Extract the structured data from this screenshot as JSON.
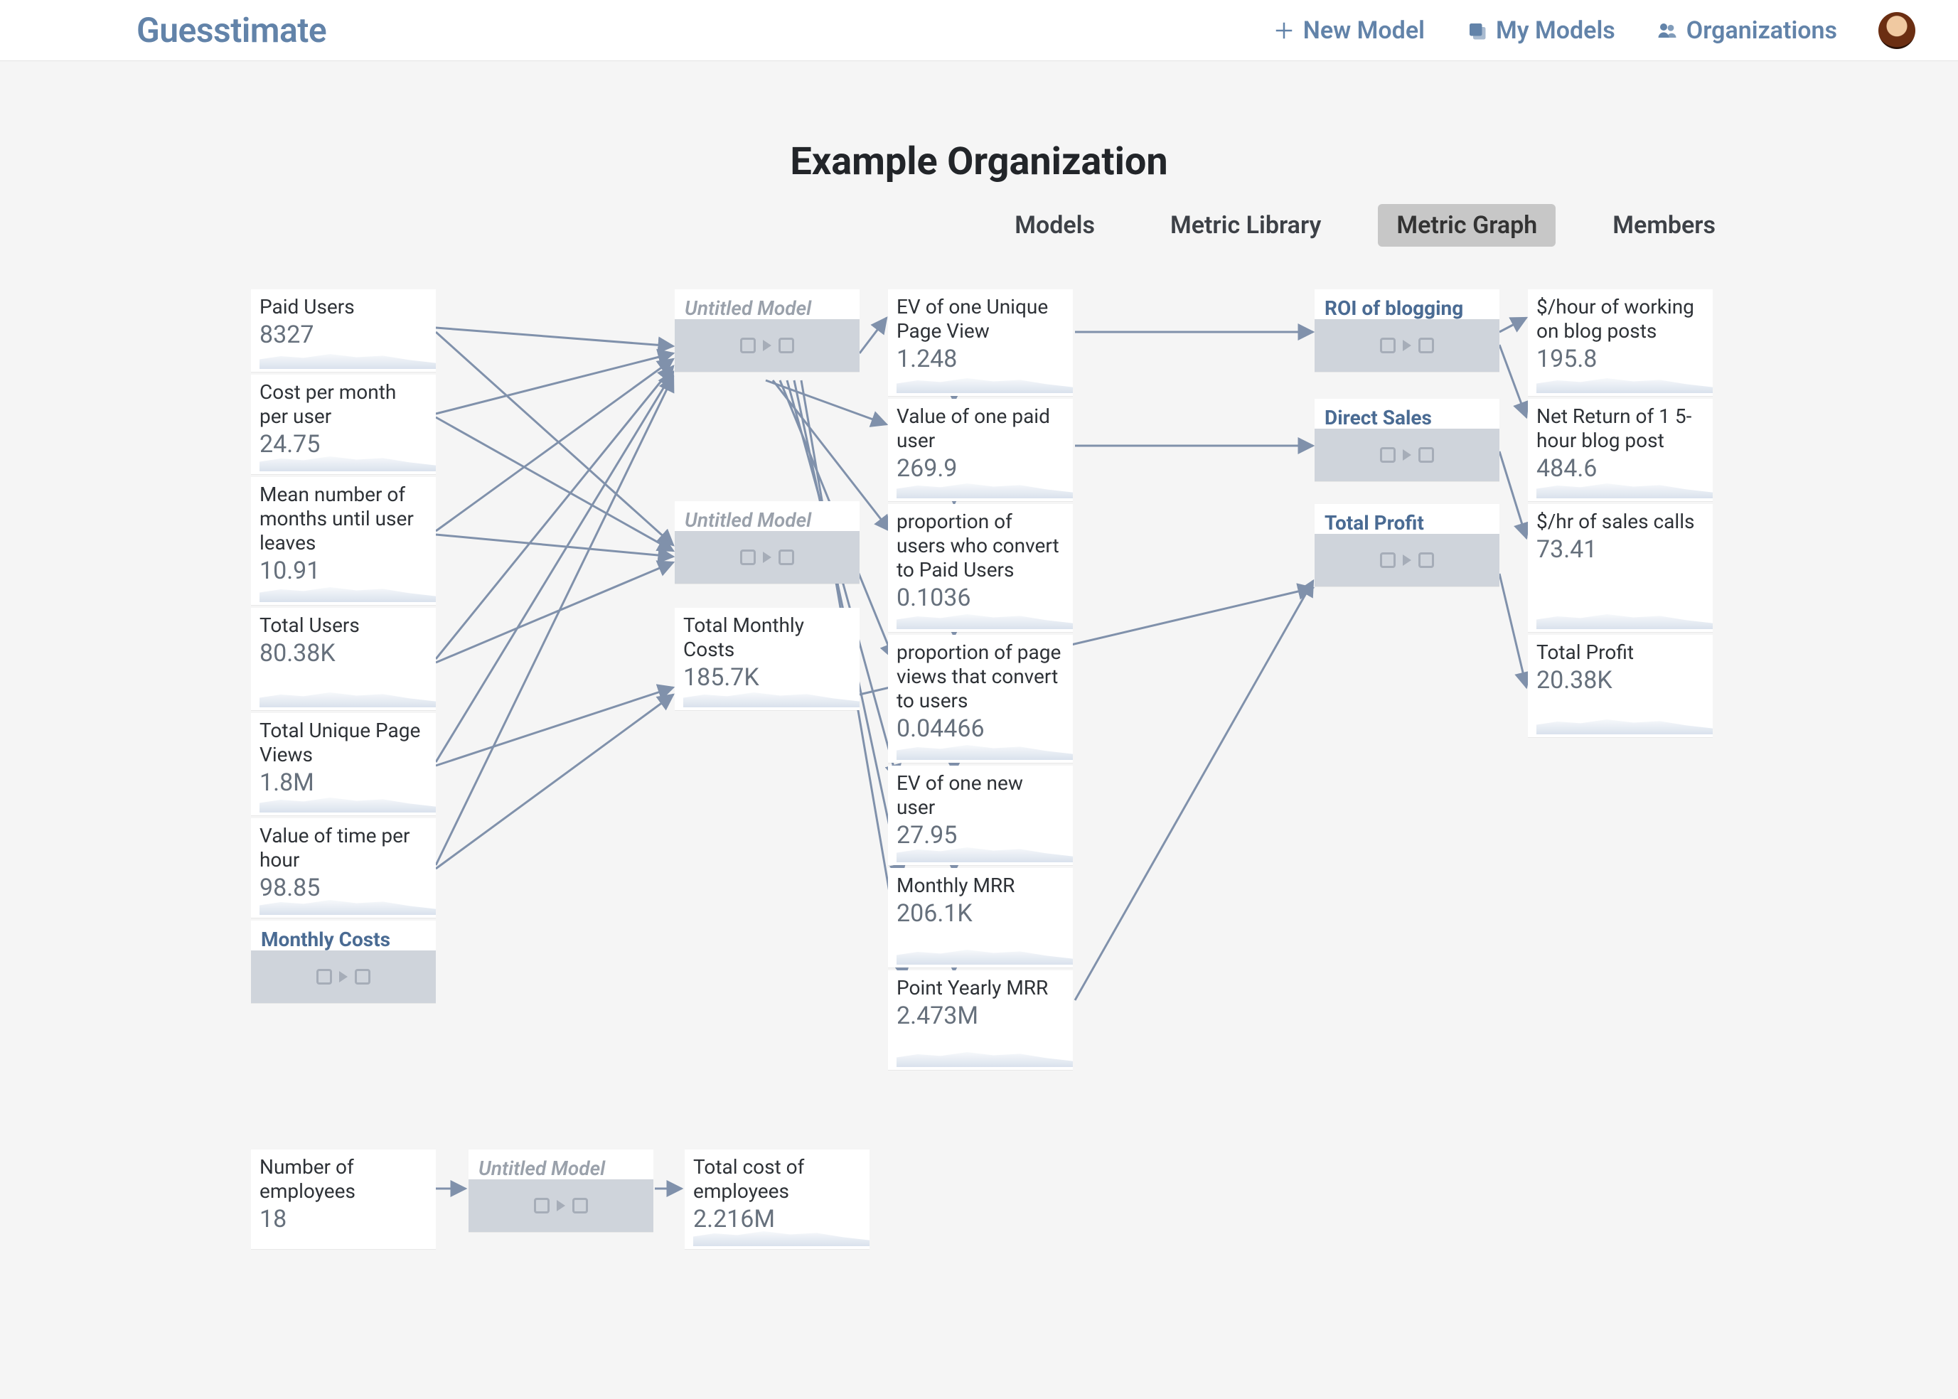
{
  "brand": "Guesstimate",
  "header": {
    "new_model": "New Model",
    "my_models": "My Models",
    "organizations": "Organizations"
  },
  "page_title": "Example Organization",
  "tabs": {
    "models": "Models",
    "metric_library": "Metric Library",
    "metric_graph": "Metric Graph",
    "members": "Members",
    "active": "metric_graph"
  },
  "nodes": {
    "paid_users": {
      "label": "Paid Users",
      "value": "8327"
    },
    "cost_per_month": {
      "label": "Cost per month per user",
      "value": "24.75"
    },
    "mean_months": {
      "label": "Mean number of months until user leaves",
      "value": "10.91"
    },
    "total_users": {
      "label": "Total Users",
      "value": "80.38K"
    },
    "unique_pv": {
      "label": "Total Unique Page Views",
      "value": "1.8M"
    },
    "value_time": {
      "label": "Value of time per hour",
      "value": "98.85"
    },
    "monthly_costs_model": {
      "label": "Monthly Costs"
    },
    "untitled_top": {
      "label": "Untitled Model"
    },
    "untitled_mid": {
      "label": "Untitled Model"
    },
    "total_monthly_costs": {
      "label": "Total Monthly Costs",
      "value": "185.7K"
    },
    "ev_unique_pv": {
      "label": "EV of one Unique Page View",
      "value": "1.248"
    },
    "value_paid_user": {
      "label": "Value of one paid user",
      "value": "269.9"
    },
    "prop_convert_paid": {
      "label": "proportion of users who convert to Paid Users",
      "value": "0.1036"
    },
    "prop_pv_to_users": {
      "label": "proportion of page views that convert to users",
      "value": "0.04466"
    },
    "ev_new_user": {
      "label": "EV of one new user",
      "value": "27.95"
    },
    "monthly_mrr": {
      "label": "Monthly MRR",
      "value": "206.1K"
    },
    "yearly_mrr": {
      "label": "Point Yearly MRR",
      "value": "2.473M"
    },
    "roi_blogging": {
      "label": "ROI of blogging"
    },
    "direct_sales": {
      "label": "Direct Sales"
    },
    "total_profit_model": {
      "label": "Total Profit"
    },
    "dollars_hr_blog": {
      "label": "$/hour of working on blog posts",
      "value": "195.8"
    },
    "net_return_blog": {
      "label": "Net Return of 1 5-hour blog post",
      "value": "484.6"
    },
    "dollars_hr_sales": {
      "label": "$/hr of sales calls",
      "value": "73.41"
    },
    "total_profit": {
      "label": "Total Profit",
      "value": "20.38K"
    },
    "num_employees": {
      "label": "Number of employees",
      "value": "18"
    },
    "untitled_bottom": {
      "label": "Untitled Model"
    },
    "total_cost_employees": {
      "label": "Total cost of employees",
      "value": "2.216M"
    }
  }
}
